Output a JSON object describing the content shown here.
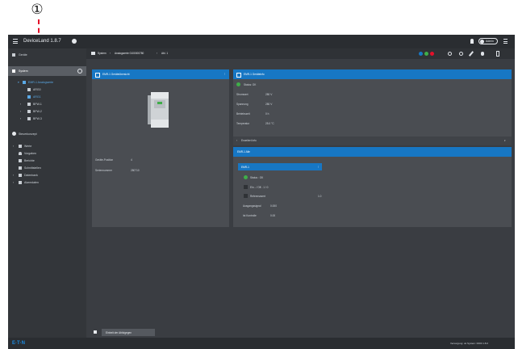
{
  "callout": {
    "number": "①"
  },
  "topbar": {
    "app_title": "DeviceLand 1.8.7",
    "user_label": "Admin"
  },
  "sidebar": {
    "items": [
      {
        "label": "Geräte"
      },
      {
        "label": "System"
      },
      {
        "label": "EMR-1 Analogwerte"
      },
      {
        "label": "ARG0"
      },
      {
        "label": "ARG1"
      },
      {
        "label": "BFW-1"
      },
      {
        "label": "BFW-2"
      },
      {
        "label": "BFW-3"
      },
      {
        "label": "Steuerkonzept"
      },
      {
        "label": "Werte"
      },
      {
        "label": "Vorgaben"
      },
      {
        "label": "Berichte"
      },
      {
        "label": "Schnittstellen"
      },
      {
        "label": "Datenbank"
      },
      {
        "label": "Alarmdaten"
      }
    ]
  },
  "breadcrumb": {
    "parts": [
      "System",
      "Analogwerte 0100000780",
      "Abl. 1"
    ]
  },
  "left_panel": {
    "title": "EMR-1 Geräteübersicht",
    "fields": [
      {
        "key": "Geräte-Position",
        "value": "4"
      },
      {
        "key": "Seriennummer",
        "value": "280710"
      }
    ]
  },
  "right_panel": {
    "title": "EMR-1 Geräteinfo",
    "status": "Status: OK",
    "fields": [
      {
        "key": "Stromwert",
        "value": "280 V"
      },
      {
        "key": "Spannung",
        "value": "280 V"
      },
      {
        "key": "Betriebszeit",
        "value": "0 h"
      },
      {
        "key": "Temperatur",
        "value": "25.0 °C"
      }
    ],
    "expander": "Erweitert Info"
  },
  "sub_panel": {
    "title": "EMR-1 Alle",
    "inner_title": "EMR-1",
    "rows": [
      {
        "label": "Status : OK",
        "value": ""
      },
      {
        "label": "Ein - / Off - 1 / 0",
        "value": ""
      },
      {
        "label": "Referenzwert",
        "value": "1.0"
      },
      {
        "label": "Ausgangssignal",
        "value": "0.000"
      },
      {
        "label": "Ist Kontrolle",
        "value": "0.00"
      }
    ]
  },
  "bottom_button": "Einheit der Abfolgegen",
  "statusbar": {
    "brand": "E·T·N",
    "right_text": "Versorgung: ok   System: 0000   1.8.0"
  },
  "colors": {
    "accent": "#1777c4",
    "annotation": "#e4102a",
    "ok": "#3fae49"
  }
}
